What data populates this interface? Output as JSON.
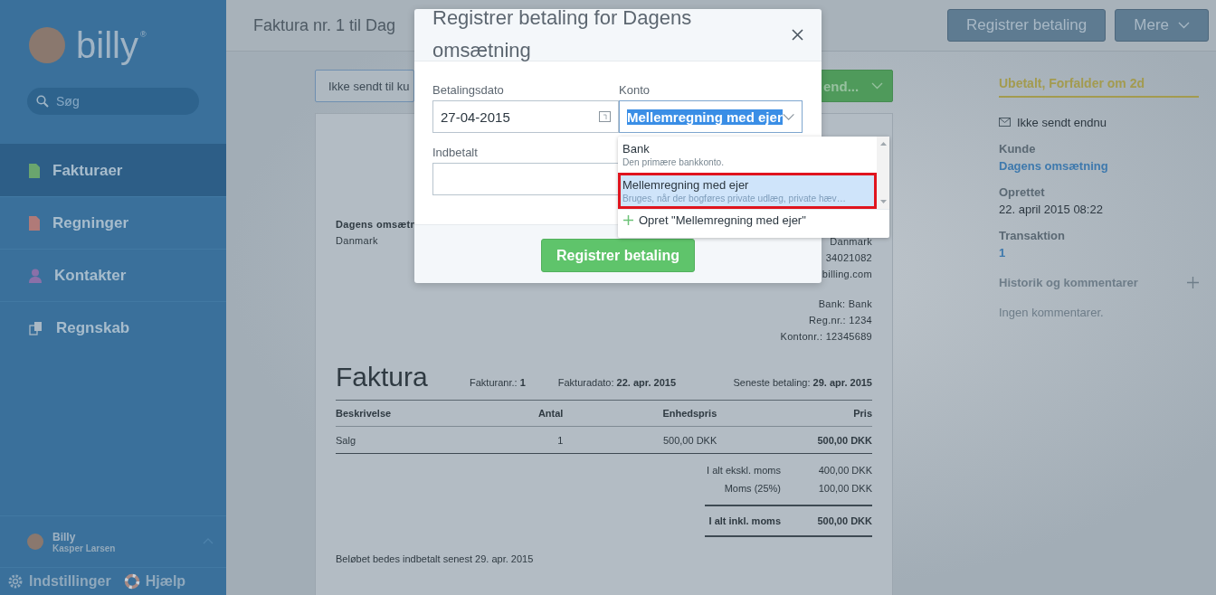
{
  "sidebar": {
    "logo": "billy",
    "logo_mark": "®",
    "search": {
      "placeholder": "Søg"
    },
    "items": [
      {
        "label": "Fakturaer",
        "selected": true,
        "kind": "document",
        "color": "#6aa56e"
      },
      {
        "label": "Regninger",
        "selected": false,
        "kind": "document",
        "color": "#b07a78"
      },
      {
        "label": "Kontakter",
        "selected": false,
        "kind": "person",
        "color": "#8a70a8"
      },
      {
        "label": "Regnskab",
        "selected": false,
        "kind": "copy",
        "color": "#a9b8c4"
      }
    ],
    "user": {
      "name": "Billy",
      "subtitle": "Kasper Larsen"
    },
    "footer_links": [
      {
        "label": "Indstillinger",
        "kind": "settings"
      },
      {
        "label": "Hjælp",
        "kind": "help"
      }
    ]
  },
  "header": {
    "title": "Faktura nr. 1 til Dag",
    "buttons": [
      {
        "label": "Registrer betaling",
        "kind": "plain"
      },
      {
        "label": "Mere",
        "kind": "menu"
      }
    ]
  },
  "toolbar": {
    "status_button": "Ikke sendt til ku",
    "send_button": "end..."
  },
  "document": {
    "customer": [
      "Dagens omsætn",
      "Danmark"
    ],
    "sender": [
      "Danmark",
      "34021082",
      "billing.com"
    ],
    "bank": [
      "Bank: Bank",
      "Reg.nr.: 1234",
      "Kontonr.: 12345689"
    ],
    "title": "Faktura",
    "meta": [
      {
        "label": "Fakturanr.:",
        "value": "1"
      },
      {
        "label": "Fakturadato:",
        "value": "22. apr. 2015"
      },
      {
        "label": "Seneste betaling:",
        "value": "29. apr. 2015"
      }
    ],
    "table": {
      "columns": [
        "Beskrivelse",
        "Antal",
        "Enhedspris",
        "Pris"
      ],
      "rows": [
        [
          "Salg",
          "1",
          "500,00 DKK",
          "500,00 DKK"
        ]
      ]
    },
    "totals": [
      {
        "label": "I alt ekskl. moms",
        "value": "400,00 DKK",
        "kind": "sub"
      },
      {
        "label": "Moms (25%)",
        "value": "100,00 DKK",
        "kind": "sub"
      },
      {
        "label": "I alt inkl. moms",
        "value": "500,00 DKK",
        "kind": "grand"
      }
    ],
    "footer": "Beløbet bedes indbetalt senest 29. apr. 2015"
  },
  "details": {
    "status": "Ubetalt, Forfalder om 2d",
    "sent_status": "Ikke sendt endnu",
    "fields": [
      {
        "label": "Kunde",
        "value": "Dagens omsætning",
        "kind": "link"
      },
      {
        "label": "Oprettet",
        "value": "22. april 2015 08:22",
        "kind": "text"
      },
      {
        "label": "Transaktion",
        "value": "1",
        "kind": "link"
      }
    ],
    "history_title": "Historik og kommentarer",
    "history_empty": "Ingen kommentarer."
  },
  "modal": {
    "title": "Registrer betaling for Dagens omsætning",
    "date_label": "Betalingsdato",
    "date_value": "27-04-2015",
    "account_label": "Konto",
    "account_value": "Mellemregning med ejer",
    "paid_label": "Indbetalt",
    "submit": "Registrer betaling",
    "dropdown": {
      "options": [
        {
          "name": "Bank",
          "description": "Den primære bankkonto.",
          "selected": false
        },
        {
          "name": "Mellemregning med ejer",
          "description": "Bruges, når der bogføres private udlæg, private hæv…",
          "selected": true
        }
      ],
      "create": "Opret \"Mellemregning med ejer\""
    }
  }
}
